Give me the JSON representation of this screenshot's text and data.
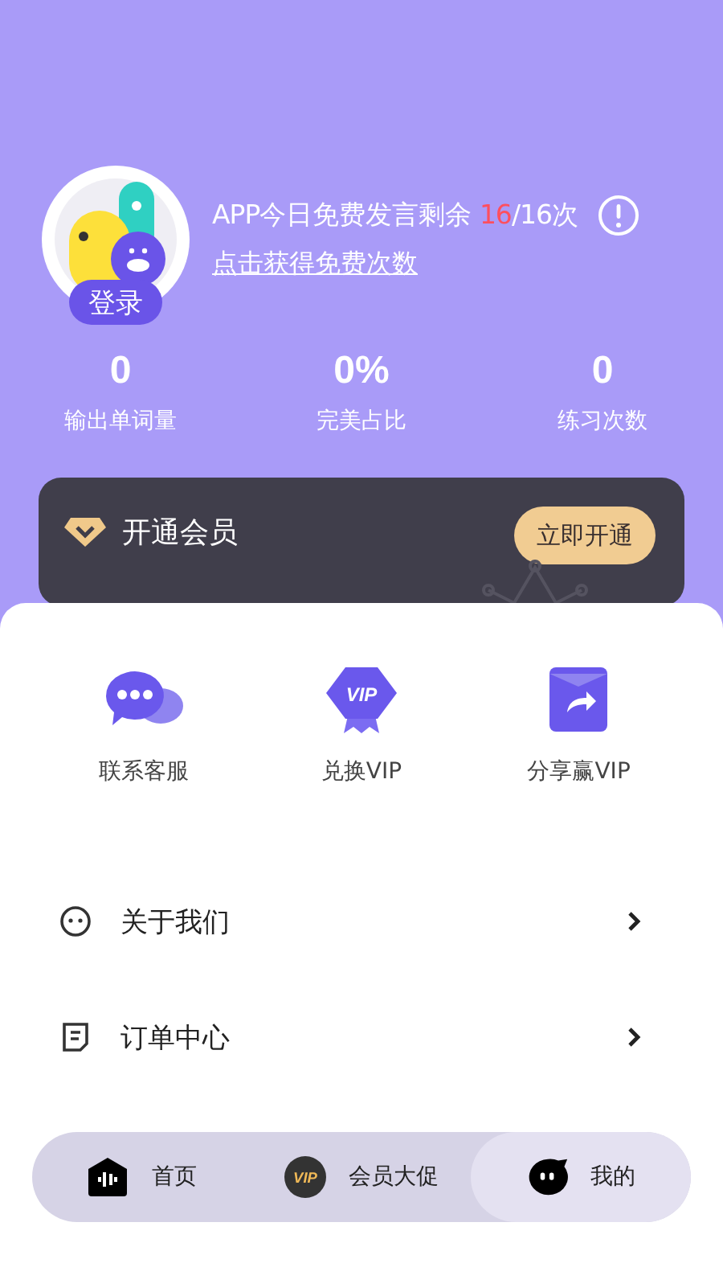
{
  "profile": {
    "login_label": "登录",
    "quota_text": "APP今日免费发言剩余 **16**/16次",
    "free_link": "点击获得免费次数"
  },
  "stats": [
    {
      "value": "0",
      "label": "输出单词量"
    },
    {
      "value": "0%",
      "label": "完美占比"
    },
    {
      "value": "0",
      "label": "练习次数"
    }
  ],
  "vip_card": {
    "title": "开通会员",
    "button": "立即开通"
  },
  "shortcuts": [
    {
      "kind": "chat",
      "label": "联系客服"
    },
    {
      "kind": "vip",
      "label": "兑换VIP",
      "badge_text": "VIP"
    },
    {
      "kind": "share",
      "label": "分享赢VIP"
    }
  ],
  "menu": [
    {
      "kind": "face",
      "label": "关于我们"
    },
    {
      "kind": "doc",
      "label": "订单中心"
    }
  ],
  "tabs": [
    {
      "kind": "home",
      "label": "首页",
      "selected": false
    },
    {
      "kind": "vip",
      "label": "会员大促",
      "selected": false,
      "badge_text": "VIP"
    },
    {
      "kind": "me",
      "label": "我的",
      "selected": true
    }
  ]
}
